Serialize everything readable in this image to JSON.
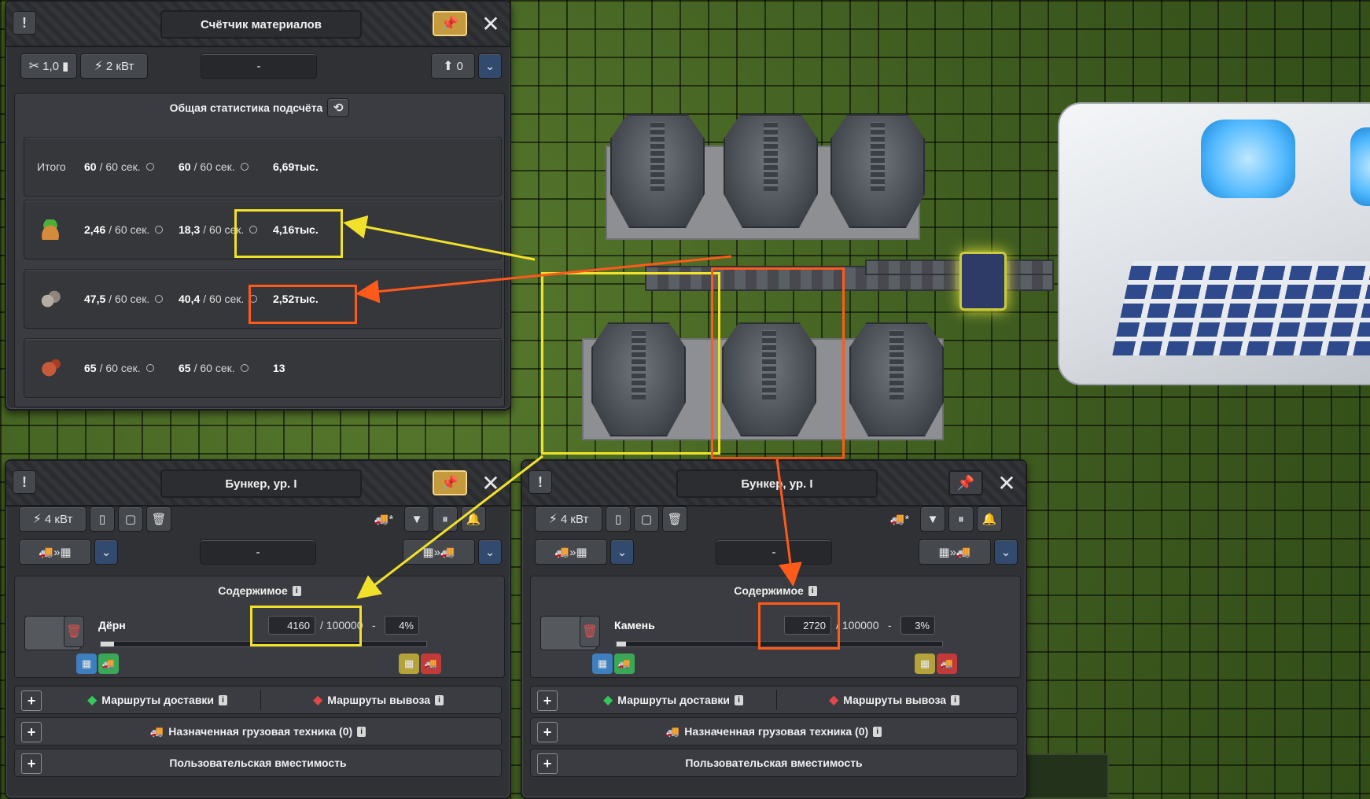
{
  "counter_panel": {
    "title": "Счётчик материалов",
    "worker_value": "1,0",
    "power": "2 кВт",
    "selector_value": "-",
    "trucks_value": "0",
    "stats_header": "Общая статистика подсчёта",
    "rows": [
      {
        "label": "Итого",
        "icon": "none",
        "rate_in": "60",
        "rate_out": "60",
        "total": "6,69тыс."
      },
      {
        "label": "",
        "icon": "sod-icon",
        "rate_in": "2,46",
        "rate_out": "18,3",
        "total": "4,16тыс."
      },
      {
        "label": "",
        "icon": "stone-icon",
        "rate_in": "47,5",
        "rate_out": "40,4",
        "total": "2,52тыс."
      },
      {
        "label": "",
        "icon": "brick-icon",
        "rate_in": "65",
        "rate_out": "65",
        "total": "13"
      }
    ],
    "period": "/ 60 сек."
  },
  "bunker_left": {
    "title": "Бункер, ур. I",
    "power": "4 кВт",
    "selector_value": "-",
    "contents_header": "Содержимое",
    "material": "Дёрн",
    "quantity": "4160",
    "capacity": "/ 100000",
    "dash": "-",
    "percent": "4%",
    "fill_fraction": 0.04,
    "delivery_routes": "Маршруты доставки",
    "export_routes": "Маршруты вывоза",
    "assigned_vehicles": "Назначенная грузовая техника (0)",
    "custom_capacity": "Пользовательская вместимость"
  },
  "bunker_right": {
    "title": "Бункер, ур. I",
    "power": "4 кВт",
    "selector_value": "-",
    "contents_header": "Содержимое",
    "material": "Камень",
    "quantity": "2720",
    "capacity": "/ 100000",
    "dash": "-",
    "percent": "3%",
    "fill_fraction": 0.03,
    "delivery_routes": "Маршруты доставки",
    "export_routes": "Маршруты вывоза",
    "assigned_vehicles": "Назначенная грузовая техника (0)",
    "custom_capacity": "Пользовательская вместимость"
  },
  "colors": {
    "highlight_yellow": "#f2e12a",
    "highlight_orange": "#ff5a1a",
    "pin_active": "#c49a3c",
    "panel_bg": "#2f3135"
  }
}
